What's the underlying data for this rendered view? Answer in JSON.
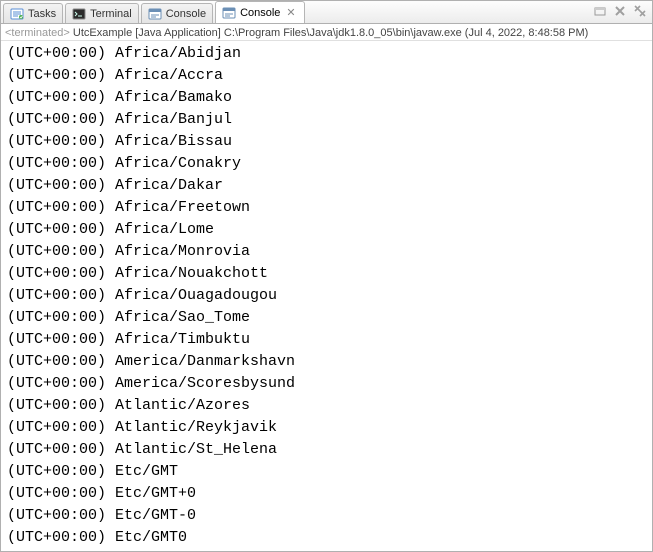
{
  "tabs": [
    {
      "label": "Tasks",
      "icon": "tasks-icon"
    },
    {
      "label": "Terminal",
      "icon": "terminal-icon"
    },
    {
      "label": "Console",
      "icon": "console-icon"
    },
    {
      "label": "Console",
      "icon": "console-icon",
      "active": true,
      "closable": true
    }
  ],
  "status": {
    "terminated": "<terminated>",
    "text": "UtcExample [Java Application] C:\\Program Files\\Java\\jdk1.8.0_05\\bin\\javaw.exe (Jul 4, 2022, 8:48:58 PM)"
  },
  "output_lines": [
    "(UTC+00:00) Africa/Abidjan",
    "(UTC+00:00) Africa/Accra",
    "(UTC+00:00) Africa/Bamako",
    "(UTC+00:00) Africa/Banjul",
    "(UTC+00:00) Africa/Bissau",
    "(UTC+00:00) Africa/Conakry",
    "(UTC+00:00) Africa/Dakar",
    "(UTC+00:00) Africa/Freetown",
    "(UTC+00:00) Africa/Lome",
    "(UTC+00:00) Africa/Monrovia",
    "(UTC+00:00) Africa/Nouakchott",
    "(UTC+00:00) Africa/Ouagadougou",
    "(UTC+00:00) Africa/Sao_Tome",
    "(UTC+00:00) Africa/Timbuktu",
    "(UTC+00:00) America/Danmarkshavn",
    "(UTC+00:00) America/Scoresbysund",
    "(UTC+00:00) Atlantic/Azores",
    "(UTC+00:00) Atlantic/Reykjavik",
    "(UTC+00:00) Atlantic/St_Helena",
    "(UTC+00:00) Etc/GMT",
    "(UTC+00:00) Etc/GMT+0",
    "(UTC+00:00) Etc/GMT-0",
    "(UTC+00:00) Etc/GMT0"
  ]
}
